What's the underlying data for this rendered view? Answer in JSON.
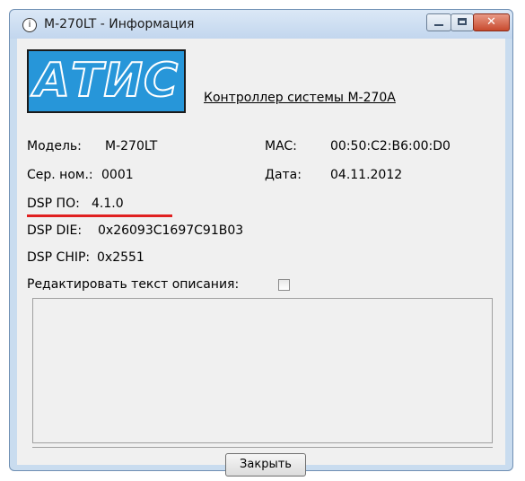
{
  "window": {
    "title": "M-270LT - Информация",
    "title_icon": "info-icon",
    "controls": {
      "minimize_icon": "minimize-icon",
      "maximize_icon": "maximize-icon",
      "close_icon": "close-icon",
      "close_glyph": "✕"
    }
  },
  "logo": {
    "text": "АТИС",
    "color": "#2796d9"
  },
  "link_text": "Контроллер системы М-270А",
  "info": {
    "model_label": "Модель:",
    "model_value": "M-270LT",
    "mac_label": "MAC:",
    "mac_value": "00:50:C2:B6:00:D0",
    "serial_label": "Сер. ном.:",
    "serial_value": "0001",
    "date_label": "Дата:",
    "date_value": "04.11.2012",
    "dsp_label": "DSP ПО:",
    "dsp_value": "4.1.0",
    "die_label": "DSP DIE:",
    "die_value": "0x26093C1697C91B03",
    "chip_label": "DSP CHIP:",
    "chip_value": "0x2551"
  },
  "edit_label": "Редактировать текст описания:",
  "edit_checked": false,
  "description_text": "",
  "close_button": "Закрыть",
  "colors": {
    "highlight_line": "#e02020",
    "close_button_red": "#c74a2e"
  }
}
